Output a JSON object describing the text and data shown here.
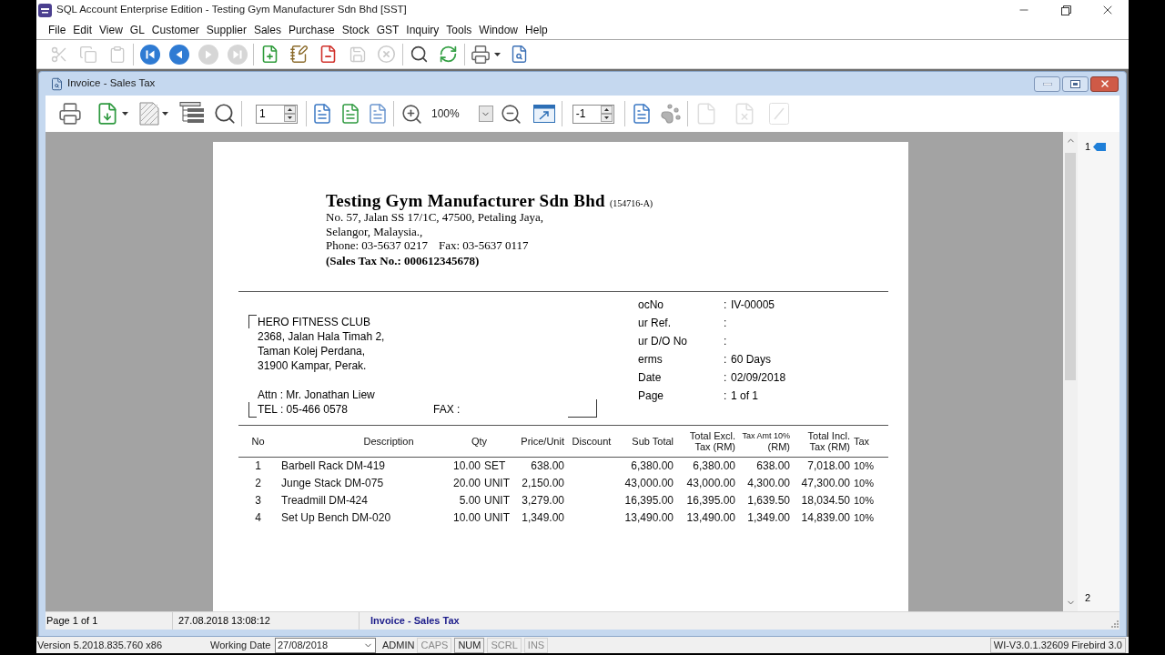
{
  "window": {
    "title": "SQL Account Enterprise Edition - Testing Gym Manufacturer Sdn Bhd [SST]"
  },
  "menu": [
    "File",
    "Edit",
    "View",
    "GL",
    "Customer",
    "Supplier",
    "Sales",
    "Purchase",
    "Stock",
    "GST",
    "Inquiry",
    "Tools",
    "Window",
    "Help"
  ],
  "toolbar": [
    {
      "disabled": true
    },
    {
      "disabled": true
    },
    {
      "disabled": true
    },
    {
      "disabled": false
    },
    {
      "disabled": false
    },
    {
      "disabled": true
    },
    {
      "disabled": true
    },
    {
      "disabled": false
    },
    {
      "disabled": false
    },
    {
      "disabled": false
    },
    {
      "disabled": true
    },
    {
      "disabled": true
    },
    {
      "disabled": false
    },
    {
      "disabled": false
    },
    {
      "disabled": false
    },
    {
      "disabled": false
    }
  ],
  "child_window": {
    "title": "Invoice - Sales Tax",
    "toolbar": {
      "buttons": [
        {
          "disabled": false
        },
        {
          "disabled": false
        },
        {
          "disabled": false
        },
        {
          "disabled": false
        },
        {
          "disabled": false
        },
        {
          "disabled": false
        },
        {
          "disabled": false
        },
        {
          "disabled": false
        },
        {
          "disabled": false
        },
        {
          "disabled": false
        },
        {
          "disabled": false
        },
        {
          "disabled": false
        },
        {
          "disabled": false
        },
        {
          "disabled": true
        },
        {
          "disabled": true
        },
        {
          "disabled": true
        }
      ],
      "page_field": "1",
      "zoom": "100%",
      "step_field": "-1"
    },
    "document": {
      "company": {
        "name": "Testing Gym Manufacturer Sdn Bhd",
        "reg_no": "(154716-A)",
        "address_lines": [
          "No. 57, Jalan SS 17/1C, 47500, Petaling Jaya,",
          "Selangor, Malaysia.,"
        ],
        "phone": "Phone: 03-5637 0217",
        "fax": "Fax: 03-5637 0117",
        "tax_no": "(Sales Tax No.: 000612345678)"
      },
      "customer": {
        "lines": [
          "HERO FITNESS CLUB",
          "2368, Jalan Hala Timah 2,",
          "Taman Kolej Perdana,",
          "31900 Kampar, Perak."
        ],
        "attn": "Attn : Mr. Jonathan Liew",
        "tel": "TEL : 05-466 0578",
        "fax": "FAX :"
      },
      "info": [
        {
          "label": "ocNo",
          "sep": ":",
          "value": "IV-00005"
        },
        {
          "label": "ur Ref.",
          "sep": ":"
        },
        {
          "label": "ur D/O No",
          "sep": ":"
        },
        {
          "label": "erms",
          "sep": ":",
          "value": "60 Days"
        },
        {
          "label": "Date",
          "sep": ":",
          "value": "02/09/2018"
        },
        {
          "label": "Page",
          "sep": ":",
          "value": "1 of 1"
        }
      ],
      "table": {
        "columns": [
          {
            "lines": [
              "No"
            ]
          },
          {
            "lines": [
              "Description"
            ]
          },
          {
            "lines": [
              "Qty"
            ]
          },
          {
            "lines": [
              "Price/Unit"
            ]
          },
          {
            "lines": [
              "Discount"
            ]
          },
          {
            "lines": [
              "Sub Total"
            ]
          },
          {
            "lines": [
              "Total Excl.",
              "Tax (RM)"
            ]
          },
          {
            "lines": [
              "Tax Amt 10%",
              "(RM)"
            ]
          },
          {
            "lines": [
              "Total Incl.",
              "Tax (RM)"
            ]
          },
          {
            "lines": [
              "Tax"
            ]
          }
        ],
        "rows": [
          {
            "no": "1",
            "description": "Barbell Rack DM-419",
            "qty": "10.00",
            "uom": "SET",
            "price": "638.00",
            "sub_total": "6,380.00",
            "total_excl": "6,380.00",
            "tax_amt": "638.00",
            "total_incl": "7,018.00",
            "tax": "10%"
          },
          {
            "no": "2",
            "description": "Junge Stack DM-075",
            "qty": "20.00",
            "uom": "UNIT",
            "price": "2,150.00",
            "sub_total": "43,000.00",
            "total_excl": "43,000.00",
            "tax_amt": "4,300.00",
            "total_incl": "47,300.00",
            "tax": "10%"
          },
          {
            "no": "3",
            "description": "Treadmill DM-424",
            "qty": "5.00",
            "uom": "UNIT",
            "price": "3,279.00",
            "sub_total": "16,395.00",
            "total_excl": "16,395.00",
            "tax_amt": "1,639.50",
            "total_incl": "18,034.50",
            "tax": "10%"
          },
          {
            "no": "4",
            "description": "Set Up Bench DM-020",
            "qty": "10.00",
            "uom": "UNIT",
            "price": "1,349.00",
            "sub_total": "13,490.00",
            "total_excl": "13,490.00",
            "tax_amt": "1,349.00",
            "total_incl": "14,839.00",
            "tax": "10%"
          }
        ]
      }
    },
    "page_nav": [
      "1",
      "2"
    ],
    "status_bar": {
      "page": "Page 1 of 1",
      "printed_at": "27.08.2018 13:08:12",
      "report_name": "Invoice - Sales Tax"
    }
  },
  "status_bar": {
    "version": "Version 5.2018.835.760 x86",
    "working_date_label": "Working Date",
    "working_date": "27/08/2018",
    "user": "ADMIN",
    "indicators": [
      {
        "label": "CAPS",
        "on": false
      },
      {
        "label": "NUM",
        "on": true
      },
      {
        "label": "SCRL",
        "on": false
      },
      {
        "label": "INS",
        "on": false
      }
    ],
    "database": "WI-V3.0.1.32609 Firebird 3.0"
  }
}
